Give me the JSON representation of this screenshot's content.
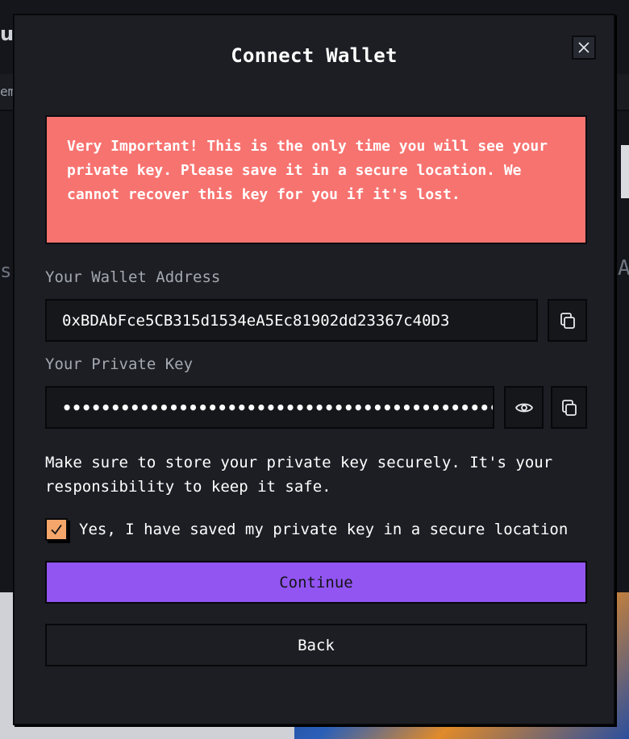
{
  "background": {
    "fragment_top": "u",
    "fragment_nav": "em",
    "fragment_left": "s",
    "fragment_right": "A"
  },
  "modal": {
    "title": "Connect Wallet",
    "close_icon": "close-icon",
    "warning_text": "Very Important! This is the only time you will see your private key. Please save it in a secure location. We cannot recover this key for you if it's lost.",
    "wallet_address": {
      "label": "Your Wallet Address",
      "value": "0xBDAbFce5CB315d1534eA5Ec81902dd23367c40D3",
      "copy_icon": "copy-icon"
    },
    "private_key": {
      "label": "Your Private Key",
      "masked_value": "••••••••••••••••••••••••••••••••••••••••••••••••••••",
      "show_icon": "eye-icon",
      "copy_icon": "copy-icon"
    },
    "notice_text": "Make sure to store your private key securely. It's your responsibility to keep it safe.",
    "confirm_checkbox": {
      "checked": true,
      "label": "Yes, I have saved my private key in a secure location"
    },
    "continue_label": "Continue",
    "back_label": "Back"
  },
  "colors": {
    "modal_bg": "#1c1e24",
    "warning_bg": "#f77370",
    "continue_bg": "#9255f2",
    "checkbox_bg": "#f5a66a"
  }
}
